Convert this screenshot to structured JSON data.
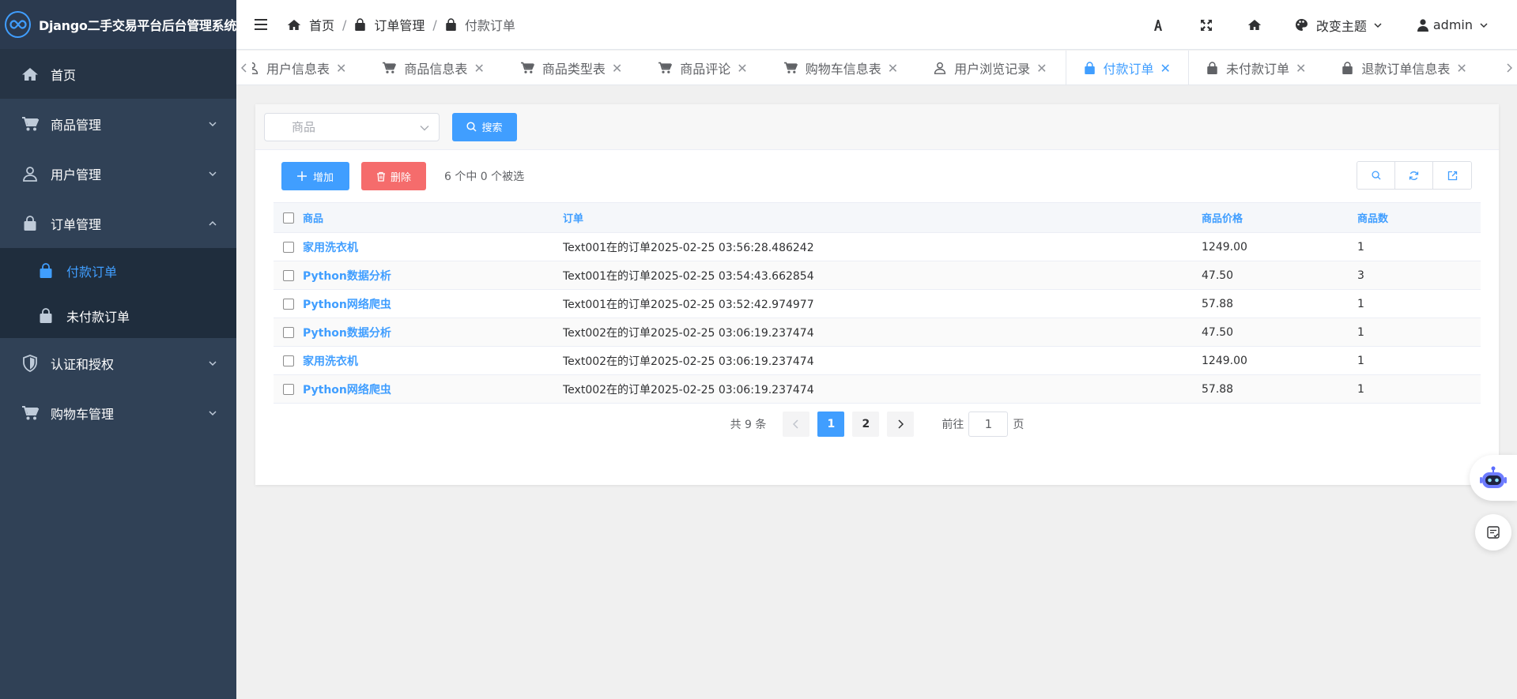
{
  "app": {
    "title": "Django二手交易平台后台管理系统"
  },
  "sidebar": {
    "home": "首页",
    "goods_mgmt": "商品管理",
    "user_mgmt": "用户管理",
    "order_mgmt": "订单管理",
    "paid_orders": "付款订单",
    "unpaid_orders": "未付款订单",
    "auth": "认证和授权",
    "cart_mgmt": "购物车管理"
  },
  "breadcrumb": {
    "home": "首页",
    "order_mgmt": "订单管理",
    "current": "付款订单"
  },
  "header": {
    "theme": "改变主题",
    "user": "admin"
  },
  "tabs": [
    "用户信息表",
    "商品信息表",
    "商品类型表",
    "商品评论",
    "购物车信息表",
    "用户浏览记录",
    "付款订单",
    "未付款订单",
    "退款订单信息表"
  ],
  "search": {
    "placeholder": "商品",
    "button": "搜索"
  },
  "toolbar": {
    "add": "增加",
    "delete": "删除",
    "selection": "6 个中 0 个被选"
  },
  "table": {
    "headers": {
      "goods": "商品",
      "order": "订单",
      "price": "商品价格",
      "qty": "商品数"
    },
    "rows": [
      {
        "goods": "家用洗衣机",
        "order": "Text001在的订单2025-02-25 03:56:28.486242",
        "price": "1249.00",
        "qty": "1"
      },
      {
        "goods": "Python数据分析",
        "order": "Text001在的订单2025-02-25 03:54:43.662854",
        "price": "47.50",
        "qty": "3"
      },
      {
        "goods": "Python网络爬虫",
        "order": "Text001在的订单2025-02-25 03:52:42.974977",
        "price": "57.88",
        "qty": "1"
      },
      {
        "goods": "Python数据分析",
        "order": "Text002在的订单2025-02-25 03:06:19.237474",
        "price": "47.50",
        "qty": "1"
      },
      {
        "goods": "家用洗衣机",
        "order": "Text002在的订单2025-02-25 03:06:19.237474",
        "price": "1249.00",
        "qty": "1"
      },
      {
        "goods": "Python网络爬虫",
        "order": "Text002在的订单2025-02-25 03:06:19.237474",
        "price": "57.88",
        "qty": "1"
      }
    ]
  },
  "pagination": {
    "total": "共 9 条",
    "page1": "1",
    "page2": "2",
    "goto": "前往",
    "current": "1",
    "page_suffix": "页"
  },
  "colors": {
    "accent": "#409eff",
    "danger": "#f56c6c",
    "sidebar": "#304156"
  }
}
